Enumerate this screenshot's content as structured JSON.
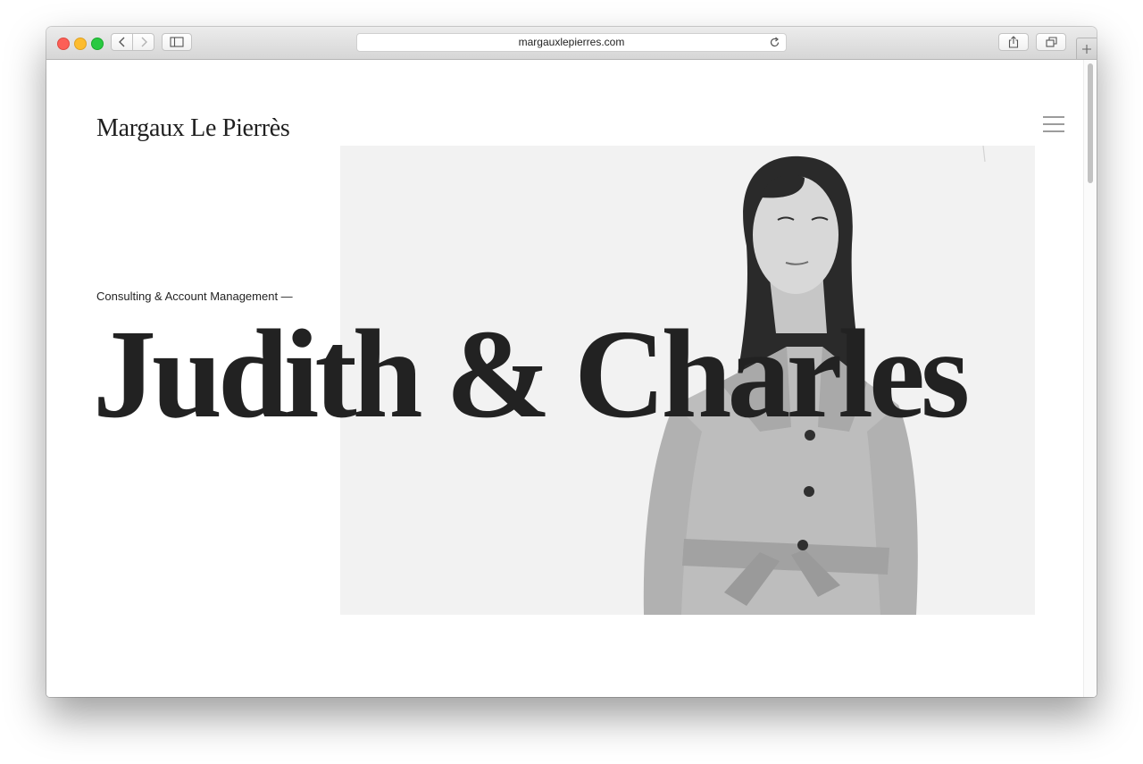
{
  "browser": {
    "url": "margauxlepierres.com",
    "icons": {
      "back": "chevron-left-icon",
      "forward": "chevron-right-icon",
      "sidebar": "sidebar-icon",
      "reload": "reload-icon",
      "share": "share-icon",
      "tabs": "tabs-overview-icon",
      "new_tab": "plus-icon"
    }
  },
  "site": {
    "logo": "Margaux Le Pierrès",
    "menu_icon": "hamburger-menu-icon"
  },
  "hero": {
    "tagline": "Consulting & Account Management —",
    "title": "Judith & Charles"
  },
  "colors": {
    "text": "#222222",
    "image_background": "#f2f2f2",
    "menu_lines": "#9c9c9c"
  }
}
